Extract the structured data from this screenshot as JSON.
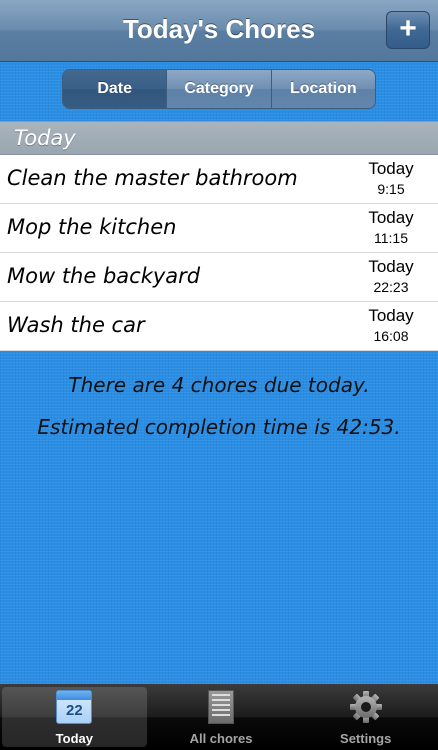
{
  "navbar": {
    "title": "Today's Chores",
    "add_label": "+"
  },
  "segments": [
    "Date",
    "Category",
    "Location"
  ],
  "section": {
    "title": "Today"
  },
  "chores": [
    {
      "title": "Clean the master bathroom",
      "day": "Today",
      "time": "9:15"
    },
    {
      "title": "Mop the kitchen",
      "day": "Today",
      "time": "11:15"
    },
    {
      "title": "Mow the backyard",
      "day": "Today",
      "time": "22:23"
    },
    {
      "title": "Wash the car",
      "day": "Today",
      "time": "16:08"
    }
  ],
  "summary": {
    "line1": "There are 4 chores due today.",
    "line2": "Estimated completion time is 42:53."
  },
  "tabbar": {
    "tabs": [
      {
        "label": "Today",
        "icon": "calendar-icon",
        "badge": "22"
      },
      {
        "label": "All chores",
        "icon": "list-icon"
      },
      {
        "label": "Settings",
        "icon": "gear-icon"
      }
    ],
    "selected": "Today"
  },
  "colors": {
    "background": "#2b8ee5",
    "navbar": "#6b8cae",
    "section_header": "#a0abb5"
  }
}
